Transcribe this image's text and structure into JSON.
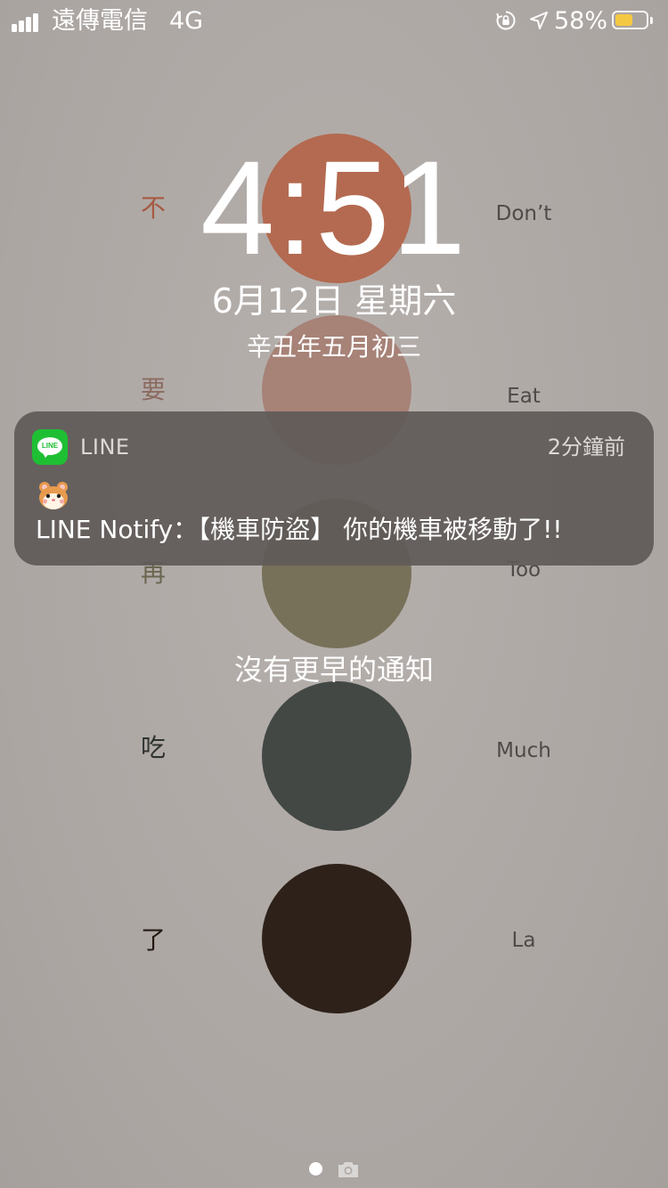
{
  "status_bar": {
    "carrier": "遠傳電信",
    "network": "4G",
    "battery_percent": "58%",
    "battery_level": 0.58,
    "battery_color": "#f5c842",
    "icons": [
      "signal-bars-icon",
      "rotation-lock-icon",
      "location-arrow-icon",
      "battery-icon"
    ]
  },
  "lock_screen": {
    "time": "4:51",
    "date": "6月12日 星期六",
    "lunar_date": "辛丑年五月初三",
    "no_older_notifications": "沒有更早的通知"
  },
  "wallpaper": {
    "circle_colors": [
      "#b36a50",
      "#a78277",
      "#77715a",
      "#434845",
      "#2e2119"
    ],
    "cjk_words": [
      {
        "text": "不",
        "color": "#a65a42"
      },
      {
        "text": "要",
        "color": "#8c6b60"
      },
      {
        "text": "再",
        "color": "#6b6650"
      },
      {
        "text": "吃",
        "color": "#2f3331"
      },
      {
        "text": "了",
        "color": "#241a13"
      }
    ],
    "english_words": [
      "Don’t",
      "Eat",
      "Too",
      "Much",
      "La"
    ]
  },
  "notification": {
    "app_name": "LINE",
    "time_ago": "2分鐘前",
    "icon_text": "LINE",
    "emoji_icon": "hamster-face-icon",
    "message": "LINE Notify：【機車防盜】 你的機車被移動了!!",
    "accent_color": "#1fbf34"
  },
  "footer": {
    "page_indicator": "current-page-dot",
    "camera": "camera-icon"
  }
}
